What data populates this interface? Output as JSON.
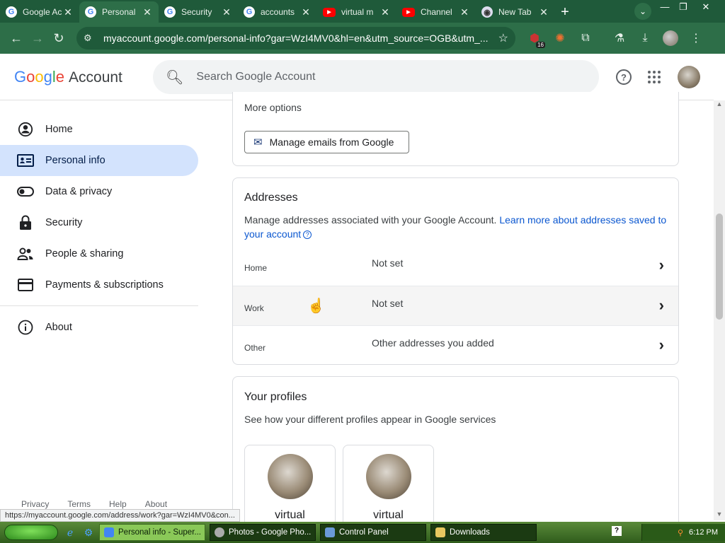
{
  "browser": {
    "tabs": [
      {
        "label": "Google Ac",
        "icon": "google-icon"
      },
      {
        "label": "Personal",
        "icon": "google-icon",
        "active": true
      },
      {
        "label": "Security",
        "icon": "google-icon"
      },
      {
        "label": "accounts",
        "icon": "chrome-icon"
      },
      {
        "label": "virtual m",
        "icon": "youtube-icon"
      },
      {
        "label": "Channel",
        "icon": "youtube-icon"
      },
      {
        "label": "New Tab",
        "icon": "chrome-icon"
      }
    ],
    "url": "myaccount.google.com/personal-info?gar=WzI4MV0&hl=en&utm_source=OGB&utm_...",
    "extension_badge": "16"
  },
  "header": {
    "logo_letters": [
      "G",
      "o",
      "o",
      "g",
      "l",
      "e"
    ],
    "logo_colors": [
      "#4285f4",
      "#ea4335",
      "#fbbc05",
      "#4285f4",
      "#34a853",
      "#ea4335"
    ],
    "account_label": "Account",
    "search_placeholder": "Search Google Account"
  },
  "sidebar": {
    "items": [
      {
        "label": "Home",
        "icon": "account-circle-icon"
      },
      {
        "label": "Personal info",
        "icon": "id-card-icon",
        "active": true
      },
      {
        "label": "Data & privacy",
        "icon": "toggle-icon"
      },
      {
        "label": "Security",
        "icon": "lock-icon"
      },
      {
        "label": "People & sharing",
        "icon": "people-icon"
      },
      {
        "label": "Payments & subscriptions",
        "icon": "credit-card-icon"
      },
      {
        "label": "About",
        "icon": "info-icon"
      }
    ],
    "footer": [
      "Privacy",
      "Terms",
      "Help",
      "About"
    ]
  },
  "email_card": {
    "more_options": "More options",
    "manage_button": "Manage emails from Google"
  },
  "addresses": {
    "title": "Addresses",
    "description": "Manage addresses associated with your Google Account.",
    "link": "Learn more about addresses saved to your account",
    "rows": [
      {
        "label": "Home",
        "value": "Not set"
      },
      {
        "label": "Work",
        "value": "Not set"
      },
      {
        "label": "Other",
        "value": "Other addresses you added"
      }
    ]
  },
  "profiles": {
    "title": "Your profiles",
    "description": "See how your different profiles appear in Google services",
    "cards": [
      {
        "name": "virtual"
      },
      {
        "name": "virtual"
      }
    ]
  },
  "status_url": "https://myaccount.google.com/address/work?gar=WzI4MV0&con...",
  "taskbar": {
    "items": [
      {
        "label": "Personal info - Super...",
        "active": true
      },
      {
        "label": "Photos - Google Pho..."
      },
      {
        "label": "Control Panel"
      },
      {
        "label": "Downloads"
      }
    ],
    "time": "6:12 PM"
  }
}
